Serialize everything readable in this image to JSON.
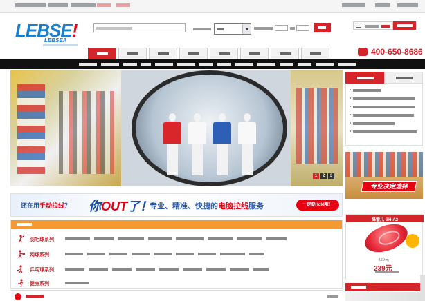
{
  "topbar": {
    "note": "Top utility bar — text illegible"
  },
  "logo": {
    "mark_blue": "LEBSE",
    "mark_red": "!",
    "en": "LEBSEA"
  },
  "search": {
    "placeholder": ""
  },
  "phone": {
    "number": "400-650-8686"
  },
  "nav": {
    "tabs": [
      {
        "label": ""
      },
      {
        "label": ""
      },
      {
        "label": ""
      },
      {
        "label": ""
      },
      {
        "label": ""
      },
      {
        "label": ""
      },
      {
        "label": ""
      },
      {
        "label": ""
      },
      {
        "label": ""
      }
    ]
  },
  "hero": {
    "slides": [
      "1",
      "2",
      "3"
    ],
    "active_slide": 1
  },
  "banner": {
    "part1": "还在用",
    "part1_red": "手动拉线",
    "part1_end": "？",
    "out_blue": "你",
    "out_red": "OUT",
    "out_end": "了！",
    "part2": "专业、精准、快捷的",
    "part2_red": "电脑拉线",
    "part2_end": "服务",
    "pill": "一定要Hold哦！"
  },
  "categories": {
    "rows": [
      {
        "name": "羽毛球系列",
        "icon": "badminton-player-icon"
      },
      {
        "name": "网球系列",
        "icon": "tennis-player-icon"
      },
      {
        "name": "乒乓球系列",
        "icon": "table-tennis-player-icon"
      },
      {
        "name": "健身系列",
        "icon": "fitness-runner-icon"
      }
    ]
  },
  "sidebar": {
    "promo_banner": "专业决定选择",
    "product": {
      "title": "烽雷儿 BH-A2",
      "old_price": "429元",
      "price": "239元"
    }
  },
  "colors": {
    "brand_red": "#d3252a",
    "brand_blue": "#1b7fd1",
    "category_orange": "#f29b35"
  }
}
